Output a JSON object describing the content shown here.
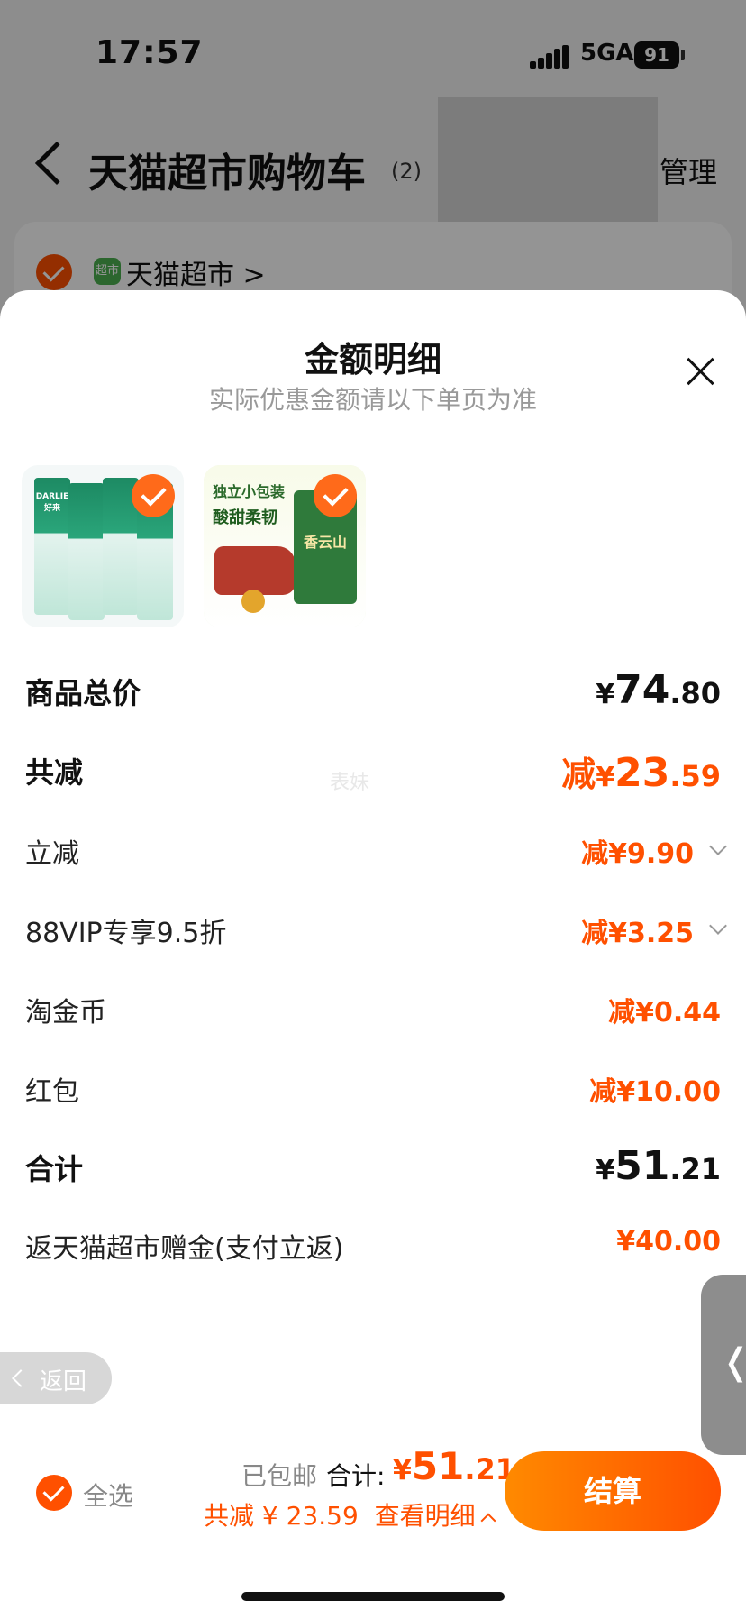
{
  "status_bar": {
    "time": "17:57",
    "network": "5GA",
    "battery": "91"
  },
  "nav": {
    "title": "天猫超市购物车",
    "count": "(2)",
    "manage": "管理"
  },
  "store": {
    "logo_text": "超市",
    "name": "天猫超市 >"
  },
  "sheet": {
    "title": "金额明细",
    "subtitle": "实际优惠金额请以下单页为准",
    "watermark": "表妹",
    "products": [
      {
        "name": "DARLIE toothpaste pack",
        "brand_text": "DARLIE 好来"
      },
      {
        "name": "snack pack",
        "line1": "独立小包装",
        "line2": "酸甜柔韧",
        "brand_text": "香云山"
      }
    ],
    "rows": [
      {
        "label": "商品总价",
        "sym": "¥",
        "int": "74",
        "dec": ".80",
        "style": "total"
      },
      {
        "label": "共减",
        "prefix": "减",
        "sym": "¥",
        "int": "23",
        "dec": ".59",
        "style": "discount-total"
      },
      {
        "label": "立减",
        "value": "减¥9.90",
        "has_arrow": true
      },
      {
        "label": "88VIP专享9.5折",
        "value": "减¥3.25",
        "has_arrow": true
      },
      {
        "label": "淘金币",
        "value": "减¥0.44",
        "has_arrow": false
      },
      {
        "label": "红包",
        "value": "减¥10.00",
        "has_arrow": false
      },
      {
        "label": "合计",
        "sym": "¥",
        "int": "51",
        "dec": ".21",
        "style": "total"
      },
      {
        "label": "返天猫超市赠金(支付立返)",
        "value": "¥40.00",
        "has_arrow": false
      }
    ]
  },
  "floating": {
    "back_label": "返回",
    "side_handle": "❬"
  },
  "footer": {
    "select_all": "全选",
    "free_shipping": "已包邮",
    "total_label": "合计:",
    "total_sym": "¥",
    "total_int": "51",
    "total_dec": ".21",
    "discount_text": "共减 ¥ 23.59",
    "detail_link": "查看明细",
    "checkout": "结算"
  },
  "colors": {
    "accent": "#ff5000",
    "accent_gradient_start": "#ff8a00"
  }
}
